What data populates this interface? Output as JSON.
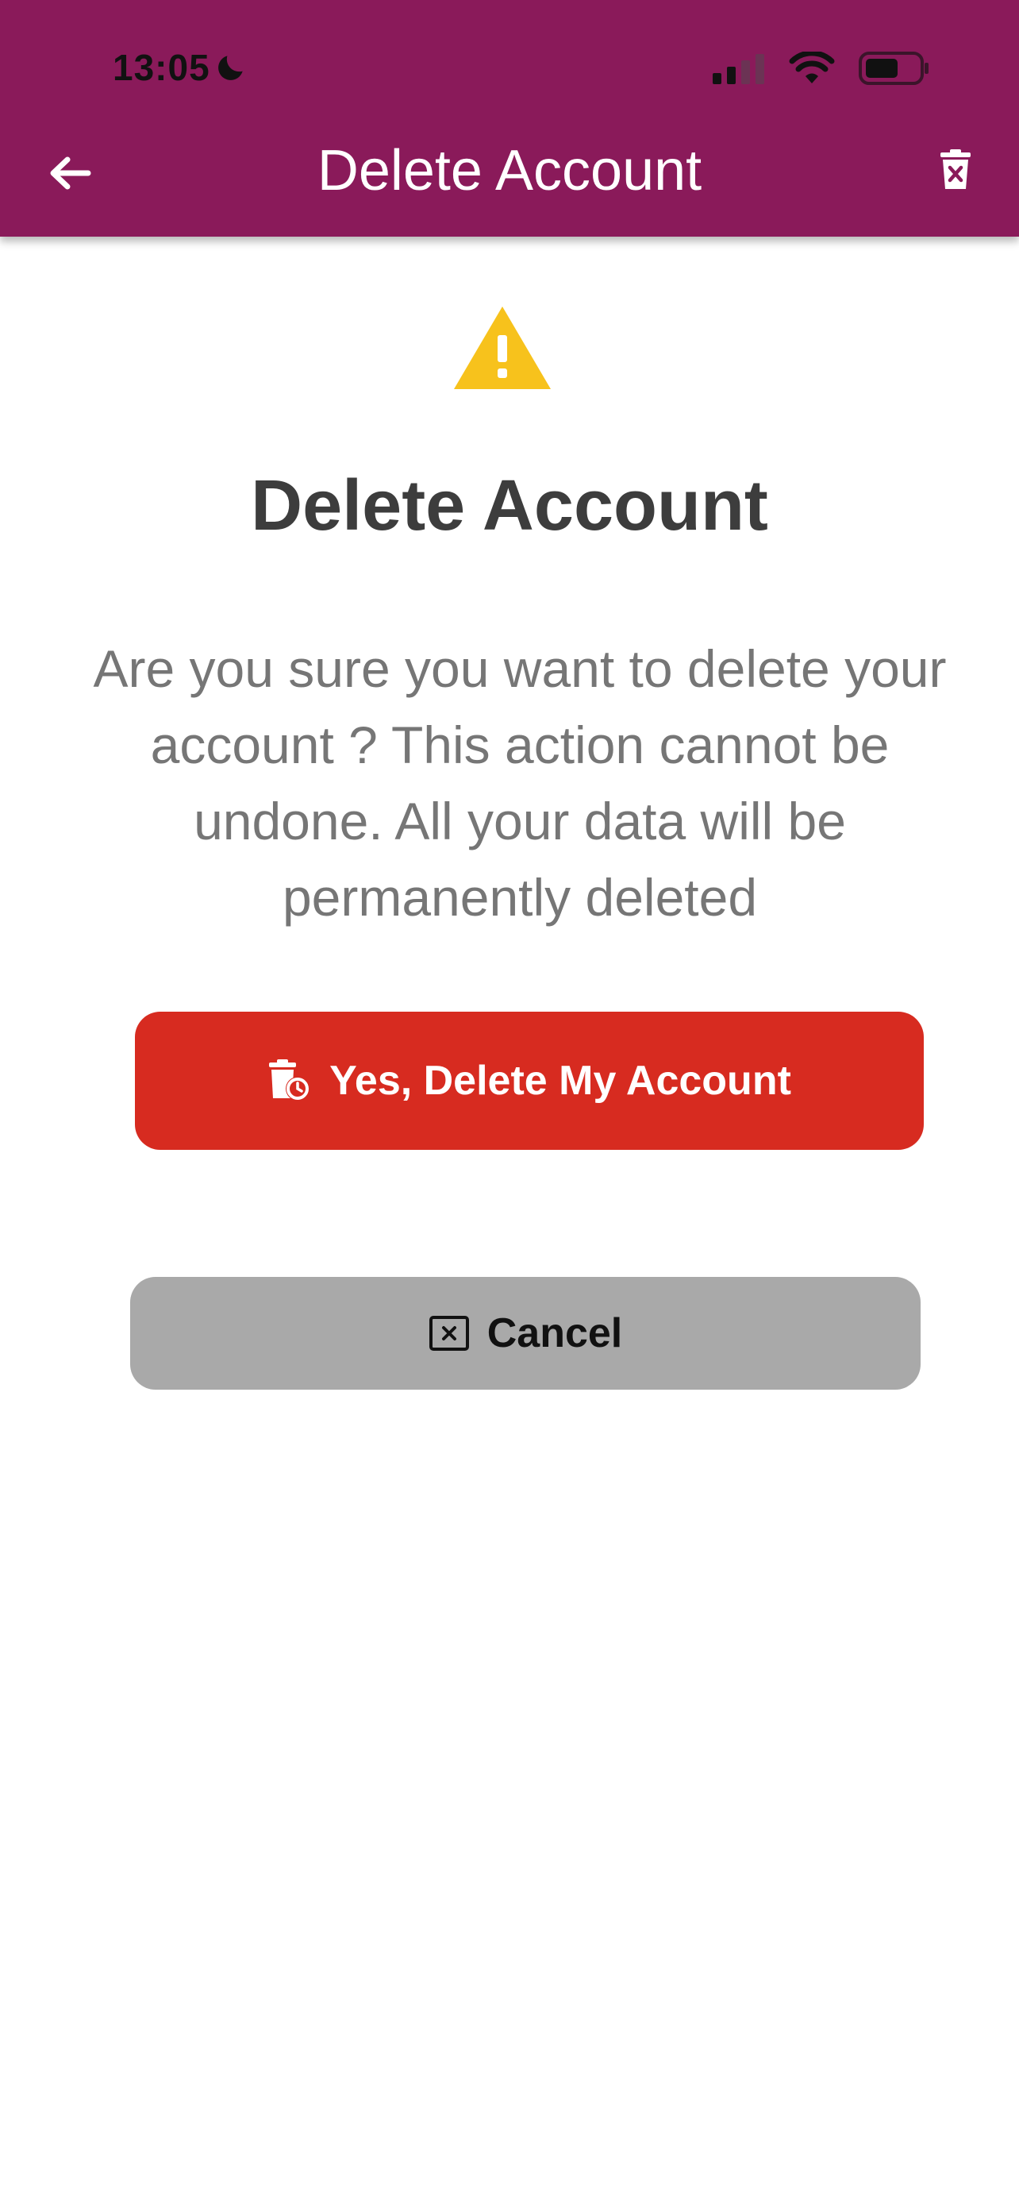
{
  "status_bar": {
    "time": "13:05",
    "icons": [
      "moon-icon",
      "signal-icon",
      "wifi-icon",
      "battery-icon"
    ]
  },
  "app_bar": {
    "title": "Delete Account",
    "back_icon": "arrow-left-icon",
    "action_icon": "trash-x-icon",
    "background_color": "#8a1a5a"
  },
  "content": {
    "icon": "warning-triangle-icon",
    "title": "Delete Account",
    "message": "Are you sure you want to delete your account ? This action cannot be undone. All your data will be permanently deleted"
  },
  "buttons": {
    "delete": {
      "label": "Yes, Delete My Account",
      "icon": "trash-clock-icon",
      "color": "#d72b20"
    },
    "cancel": {
      "label": "Cancel",
      "icon": "close-box-icon",
      "color": "#a9a9a9"
    }
  }
}
